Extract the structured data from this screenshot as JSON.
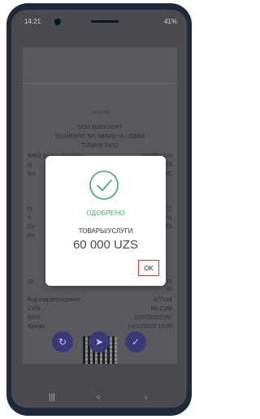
{
  "statusbar": {
    "time": "14:21",
    "status": "41%"
  },
  "receipt": {
    "brand": "ОМАНТА",
    "merchant_name": "OOO MAYASOFT",
    "merchant_addr1": "TOSHKENT SH, MIRZO ULUGBEK",
    "merchant_addr2": "TUMANI 54/17",
    "rows_top": [
      {
        "k": "МФО банка-эквайера",
        "v": "0000001125"
      },
      {
        "k": "N",
        "v": "ZS"
      },
      {
        "k": "Ma",
        "v": "02"
      }
    ],
    "rows_mid": [
      {
        "k": "N",
        "v": "27"
      },
      {
        "k": "A",
        "v": "01"
      },
      {
        "k": "Cy",
        "v": "ZS"
      },
      {
        "k": "Ko",
        "v": ""
      }
    ],
    "rows_id": [
      {
        "k": "ID",
        "v": "71"
      },
      {
        "k": "",
        "v": "9b"
      }
    ],
    "rows_bottom": [
      {
        "k": "Код подтверждения",
        "v": "477244"
      },
      {
        "k": "CVM",
        "v": "No CVM"
      },
      {
        "k": "RRN",
        "v": "228709302567"
      },
      {
        "k": "Время",
        "v": "14/10/2022 14:20"
      }
    ]
  },
  "dialog": {
    "status": "ОДОБРЕНО",
    "label": "ТОВАРЫ/УСЛУГИ",
    "amount": "60 000 UZS",
    "ok": "OK"
  },
  "nav": {
    "recent": "|||",
    "home": "○",
    "back": "‹"
  },
  "fabs": {
    "left": "↻",
    "center": "➤",
    "right": "✓"
  },
  "colors": {
    "success": "#3ea85f",
    "highlight": "#d03a2f",
    "fab": "#3a3a78"
  }
}
